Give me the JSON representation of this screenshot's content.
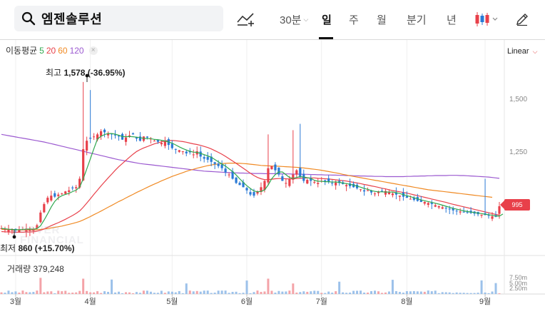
{
  "search": {
    "value": "엠젠솔루션"
  },
  "icons": {
    "search": "search-icon",
    "compare": "compare-chart-icon",
    "chart_type": "candlestick-icon",
    "draw": "pencil-icon"
  },
  "timeframes": [
    {
      "label": "30분",
      "dropdown": true,
      "active": false
    },
    {
      "label": "일",
      "dropdown": false,
      "active": true
    },
    {
      "label": "주",
      "dropdown": false,
      "active": false
    },
    {
      "label": "월",
      "dropdown": false,
      "active": false
    },
    {
      "label": "분기",
      "dropdown": false,
      "active": false
    },
    {
      "label": "년",
      "dropdown": false,
      "active": false
    }
  ],
  "moving_average": {
    "label": "이동평균",
    "periods": [
      {
        "text": "5",
        "color": "#2fa84f"
      },
      {
        "text": "20",
        "color": "#e8404a"
      },
      {
        "text": "60",
        "color": "#f08a24"
      },
      {
        "text": "120",
        "color": "#9b59d0"
      }
    ]
  },
  "scale": {
    "label": "Linear"
  },
  "high_marker": {
    "label": "최고",
    "value": "1,578 (-36.95%)"
  },
  "low_marker": {
    "label": "최저",
    "value": "860 (+15.70%)"
  },
  "current_price": {
    "value": "995"
  },
  "volume": {
    "label": "거래량",
    "value": "379,248"
  },
  "watermark": {
    "line1": "NAVER",
    "line2": "FINANCIAL"
  },
  "colors": {
    "up": "#e8404a",
    "down": "#2a7ad6",
    "vol_up": "#f4a3a8",
    "vol_down": "#9cc1ea"
  },
  "chart_data": {
    "type": "candlestick",
    "price_axis": {
      "ticks": [
        "1,500",
        "1,250"
      ],
      "tick_values": [
        1500,
        1250
      ],
      "range": [
        830,
        1700
      ]
    },
    "volume_axis": {
      "ticks": [
        "7.50m",
        "5.00m",
        "2.50m"
      ]
    },
    "x_axis": {
      "ticks": [
        "3월",
        "4월",
        "5월",
        "6월",
        "7월",
        "8월",
        "9월"
      ],
      "tick_index": [
        4,
        25,
        48,
        69,
        90,
        114,
        136
      ]
    },
    "closes": [
      885,
      882,
      880,
      878,
      876,
      879,
      881,
      884,
      882,
      880,
      900,
      960,
      1000,
      1030,
      1040,
      1035,
      1045,
      1050,
      1060,
      1065,
      1075,
      1080,
      1120,
      1260,
      1300,
      1310,
      1320,
      1330,
      1345,
      1340,
      1335,
      1330,
      1325,
      1320,
      1305,
      1315,
      1325,
      1330,
      1310,
      1300,
      1320,
      1315,
      1310,
      1300,
      1295,
      1290,
      1300,
      1280,
      1265,
      1260,
      1255,
      1250,
      1240,
      1245,
      1235,
      1250,
      1225,
      1215,
      1210,
      1200,
      1190,
      1180,
      1170,
      1150,
      1140,
      1120,
      1100,
      1090,
      1080,
      1065,
      1045,
      1040,
      1060,
      1080,
      1110,
      1170,
      1180,
      1160,
      1140,
      1110,
      1100,
      1120,
      1140,
      1160,
      1130,
      1110,
      1115,
      1110,
      1105,
      1100,
      1110,
      1108,
      1105,
      1100,
      1102,
      1100,
      1095,
      1090,
      1085,
      1080,
      1075,
      1070,
      1060,
      1065,
      1055,
      1050,
      1058,
      1060,
      1062,
      1055,
      1050,
      1045,
      1040,
      1035,
      1030,
      1025,
      1020,
      1015,
      1010,
      1010,
      1005,
      1000,
      995,
      990,
      985,
      980,
      975,
      970,
      968,
      965,
      962,
      960,
      958,
      955,
      952,
      950,
      948,
      945,
      942,
      940,
      990
    ],
    "ma5": [
      885,
      883,
      881,
      880,
      879,
      879,
      880,
      881,
      882,
      881,
      884,
      897,
      924,
      954,
      986,
      1013,
      1030,
      1040,
      1046,
      1051,
      1059,
      1066,
      1080,
      1120,
      1167,
      1214,
      1262,
      1308,
      1321,
      1329,
      1334,
      1334,
      1331,
      1326,
      1320,
      1319,
      1320,
      1319,
      1317,
      1315,
      1311,
      1310,
      1310,
      1306,
      1305,
      1302,
      1299,
      1294,
      1289,
      1280,
      1271,
      1263,
      1256,
      1250,
      1246,
      1245,
      1240,
      1234,
      1228,
      1222,
      1211,
      1200,
      1190,
      1180,
      1167,
      1154,
      1138,
      1120,
      1103,
      1087,
      1074,
      1062,
      1058,
      1060,
      1067,
      1090,
      1120,
      1140,
      1152,
      1152,
      1139,
      1126,
      1122,
      1126,
      1130,
      1128,
      1125,
      1122,
      1113,
      1108,
      1108,
      1106,
      1106,
      1104,
      1105,
      1103,
      1100,
      1097,
      1094,
      1090,
      1085,
      1080,
      1074,
      1070,
      1064,
      1060,
      1058,
      1058,
      1057,
      1057,
      1057,
      1054,
      1050,
      1045,
      1040,
      1035,
      1030,
      1025,
      1020,
      1016,
      1012,
      1008,
      1004,
      1000,
      995,
      990,
      985,
      980,
      976,
      972,
      968,
      965,
      962,
      960,
      957,
      955,
      952,
      950,
      947,
      944,
      943,
      953
    ],
    "ma20": [
      870,
      869,
      868,
      868,
      867,
      867,
      867,
      868,
      868,
      869,
      872,
      876,
      882,
      890,
      898,
      905,
      912,
      920,
      928,
      937,
      946,
      956,
      968,
      985,
      1005,
      1025,
      1046,
      1066,
      1086,
      1105,
      1124,
      1142,
      1160,
      1177,
      1192,
      1207,
      1222,
      1236,
      1249,
      1258,
      1266,
      1272,
      1279,
      1285,
      1290,
      1295,
      1299,
      1301,
      1301,
      1300,
      1298,
      1296,
      1293,
      1289,
      1285,
      1282,
      1278,
      1273,
      1268,
      1261,
      1253,
      1245,
      1236,
      1226,
      1215,
      1204,
      1193,
      1181,
      1170,
      1158,
      1146,
      1135,
      1126,
      1120,
      1116,
      1116,
      1118,
      1120,
      1121,
      1121,
      1120,
      1119,
      1120,
      1121,
      1122,
      1123,
      1124,
      1124,
      1124,
      1122,
      1121,
      1120,
      1119,
      1117,
      1115,
      1113,
      1111,
      1109,
      1106,
      1103,
      1100,
      1097,
      1093,
      1090,
      1086,
      1083,
      1079,
      1075,
      1072,
      1068,
      1064,
      1061,
      1058,
      1055,
      1052,
      1048,
      1044,
      1040,
      1036,
      1032,
      1028,
      1024,
      1020,
      1016,
      1012,
      1008,
      1003,
      999,
      995,
      991,
      987,
      983,
      979,
      975,
      971,
      967,
      963,
      959,
      955,
      951,
      948
    ],
    "ma60": [
      880,
      880,
      879,
      879,
      878,
      878,
      878,
      878,
      878,
      878,
      879,
      880,
      882,
      884,
      887,
      890,
      893,
      896,
      900,
      904,
      908,
      913,
      918,
      925,
      933,
      941,
      950,
      958,
      967,
      976,
      985,
      994,
      1003,
      1012,
      1020,
      1029,
      1038,
      1046,
      1055,
      1063,
      1071,
      1079,
      1087,
      1095,
      1102,
      1110,
      1117,
      1124,
      1131,
      1137,
      1143,
      1149,
      1155,
      1160,
      1165,
      1170,
      1174,
      1178,
      1182,
      1185,
      1188,
      1190,
      1192,
      1193,
      1194,
      1194,
      1194,
      1193,
      1192,
      1191,
      1189,
      1187,
      1185,
      1183,
      1182,
      1181,
      1180,
      1180,
      1179,
      1178,
      1177,
      1176,
      1175,
      1174,
      1173,
      1171,
      1169,
      1167,
      1165,
      1163,
      1160,
      1157,
      1154,
      1151,
      1148,
      1145,
      1141,
      1138,
      1134,
      1131,
      1128,
      1125,
      1122,
      1119,
      1116,
      1113,
      1110,
      1107,
      1104,
      1101,
      1098,
      1095,
      1092,
      1089,
      1086,
      1083,
      1080,
      1077,
      1074,
      1071,
      1068,
      1066,
      1064,
      1062,
      1060,
      1058,
      1056,
      1054,
      1052,
      1050,
      1048,
      1046,
      1044,
      1042,
      1040,
      1038,
      1036,
      1034,
      1032
    ],
    "ma120": [
      1330,
      1327,
      1324,
      1321,
      1318,
      1315,
      1312,
      1309,
      1306,
      1303,
      1300,
      1297,
      1294,
      1290,
      1286,
      1282,
      1278,
      1274,
      1270,
      1266,
      1262,
      1258,
      1254,
      1250,
      1246,
      1242,
      1238,
      1234,
      1230,
      1226,
      1222,
      1218,
      1214,
      1210,
      1207,
      1204,
      1201,
      1198,
      1195,
      1192,
      1190,
      1188,
      1186,
      1184,
      1182,
      1180,
      1178,
      1176,
      1174,
      1172,
      1170,
      1168,
      1166,
      1164,
      1162,
      1160,
      1158,
      1156,
      1155,
      1154,
      1153,
      1152,
      1151,
      1150,
      1149,
      1148,
      1148,
      1147,
      1147,
      1146,
      1146,
      1145,
      1145,
      1145,
      1144,
      1144,
      1144,
      1144,
      1143,
      1143,
      1143,
      1143,
      1142,
      1142,
      1142,
      1141,
      1141,
      1140,
      1140,
      1139,
      1139,
      1138,
      1138,
      1137,
      1137,
      1136,
      1136,
      1135,
      1135,
      1134,
      1134,
      1133,
      1133,
      1132,
      1132,
      1131,
      1131,
      1131,
      1130,
      1130,
      1130,
      1130,
      1130,
      1130,
      1131,
      1131,
      1132,
      1132,
      1133,
      1133,
      1134,
      1134,
      1135,
      1135,
      1135,
      1135,
      1136,
      1136,
      1136,
      1135,
      1135,
      1134,
      1133,
      1132,
      1131,
      1130,
      1129,
      1128,
      1126,
      1124,
      1122
    ],
    "volume_spikes": [
      11,
      23,
      31,
      52,
      69,
      75,
      82,
      95,
      110,
      135,
      139
    ]
  }
}
